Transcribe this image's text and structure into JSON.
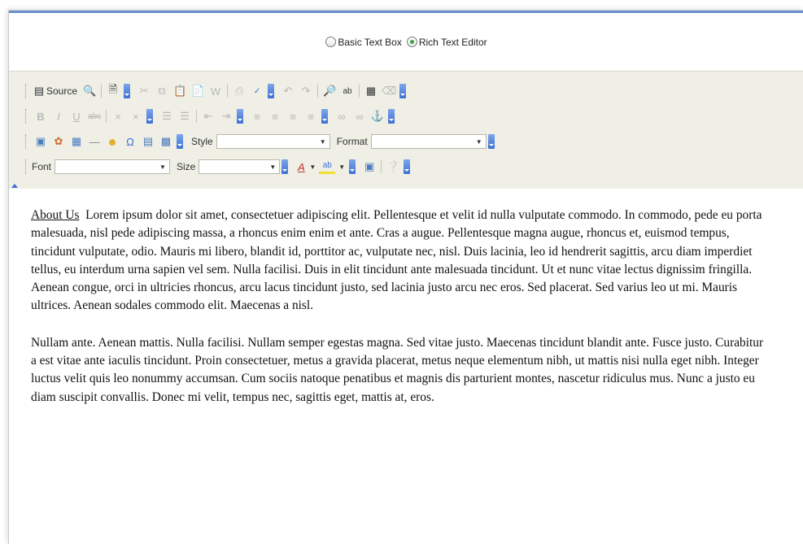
{
  "mode": {
    "basic_label": "Basic Text Box",
    "rich_label": "Rich Text Editor",
    "selected": "Rich Text Editor"
  },
  "toolbar": {
    "source_label": "Source",
    "style_label": "Style",
    "format_label": "Format",
    "font_label": "Font",
    "size_label": "Size",
    "style_value": "",
    "format_value": "",
    "font_value": "",
    "size_value": ""
  },
  "content": {
    "link_text": "About Us",
    "paragraph1": "Lorem ipsum dolor sit amet, consectetuer adipiscing elit. Pellentesque et velit id nulla vulputate commodo. In commodo, pede eu porta malesuada, nisl pede adipiscing massa, a rhoncus enim enim et ante. Cras a augue. Pellentesque magna augue, rhoncus et, euismod tempus, tincidunt vulputate, odio. Mauris mi libero, blandit id, porttitor ac, vulputate nec, nisl. Duis lacinia, leo id hendrerit sagittis, arcu diam imperdiet tellus, eu interdum urna sapien vel sem. Nulla facilisi. Duis in elit tincidunt ante malesuada tincidunt. Ut et nunc vitae lectus dignissim fringilla. Aenean congue, orci in ultricies rhoncus, arcu lacus tincidunt justo, sed lacinia justo arcu nec eros. Sed placerat. Sed varius leo ut mi. Mauris ultrices. Aenean sodales commodo elit. Maecenas a nisl.",
    "paragraph2": "Nullam ante. Aenean mattis. Nulla facilisi. Nullam semper egestas magna. Sed vitae justo. Maecenas tincidunt blandit ante. Fusce justo. Curabitur a est vitae ante iaculis tincidunt. Proin consectetuer, metus a gravida placerat, metus neque elementum nibh, ut mattis nisi nulla eget nibh. Integer luctus velit quis leo nonummy accumsan. Cum sociis natoque penatibus et magnis dis parturient montes, nascetur ridiculus mus. Nunc a justo eu diam suscipit convallis. Donec mi velit, tempus nec, sagittis eget, mattis at, eros."
  },
  "colors": {
    "accent_blue": "#3b6fd4",
    "toolbar_bg": "#efefe6",
    "radio_selected": "#3aa53a"
  }
}
